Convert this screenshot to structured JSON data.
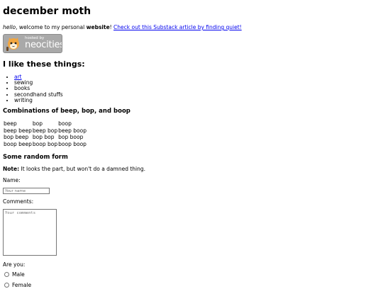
{
  "page": {
    "title": "december moth",
    "intro": {
      "greeting": "hello",
      "welcome": ", welcome to my personal ",
      "bold_word": "website",
      "exclaim": "! ",
      "link": "Check out this Substack article by finding quiet!"
    },
    "badge": {
      "hosted": "hosted by",
      "brand": "neocities"
    },
    "likes": {
      "heading": "I like these things:",
      "items": [
        "art",
        "sewing",
        "books",
        "secondhand stuffs",
        "writing"
      ]
    },
    "combos": {
      "heading": "Combinations of beep, bop, and boop",
      "rows": [
        [
          "beep",
          "bop",
          "boop"
        ],
        [
          "beep beep",
          "beep bop",
          "beep boop"
        ],
        [
          "bop beep",
          "bop bop",
          "bop boop"
        ],
        [
          "boop beep",
          "boop bop",
          "boop boop"
        ]
      ]
    },
    "form": {
      "heading": "Some random form",
      "note_label": "Note:",
      "note_text": " It looks the part, but won't do a damned thing.",
      "name_label": "Name:",
      "name_placeholder": "Your name",
      "comments_label": "Comments:",
      "comments_placeholder": "Your comments",
      "are_you_label": "Are you:",
      "options": [
        "Male",
        "Female"
      ]
    }
  }
}
